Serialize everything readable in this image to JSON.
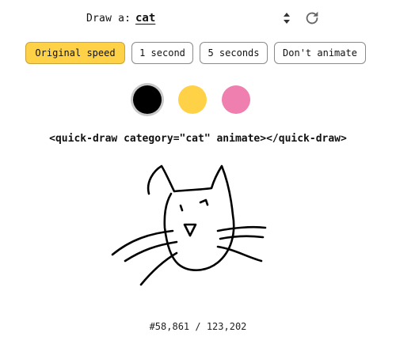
{
  "header": {
    "draw_label": "Draw a:",
    "category": "cat",
    "stepper_icon": "up-down-arrows",
    "refresh_icon": "refresh"
  },
  "speed_buttons": {
    "original": "Original speed",
    "one_second": "1 second",
    "five_seconds": "5 seconds",
    "dont_animate": "Don't animate",
    "active": "original"
  },
  "colors": {
    "black": "#000000",
    "yellow": "#ffd147",
    "pink": "#ef7fae",
    "selected": "black"
  },
  "code_snippet": "<quick-draw category=\"cat\" animate></quick-draw>",
  "counter": "#58,861 / 123,202",
  "stroke_color": "#000000"
}
